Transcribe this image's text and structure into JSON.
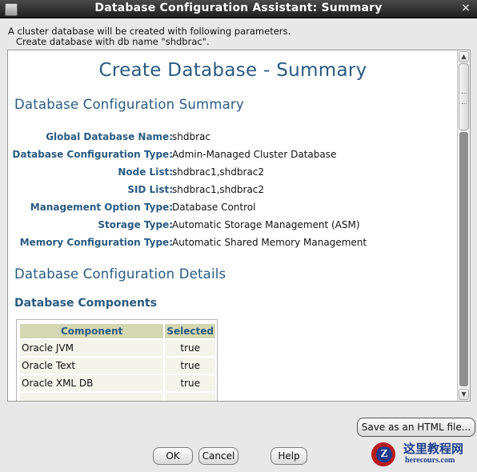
{
  "window": {
    "title": "Database Configuration Assistant: Summary",
    "close_glyph": "×"
  },
  "intro": {
    "line1": "A cluster database will be created with following parameters.",
    "line2": "Create database with db name \"shdbrac\"."
  },
  "summary": {
    "title": "Create Database - Summary",
    "section_heading": "Database Configuration Summary",
    "fields": [
      {
        "label": "Global Database Name:",
        "value": "shdbrac"
      },
      {
        "label": "Database Configuration Type:",
        "value": "Admin-Managed Cluster Database"
      },
      {
        "label": "Node List:",
        "value": "shdbrac1,shdbrac2"
      },
      {
        "label": "SID List:",
        "value": "shdbrac1,shdbrac2"
      },
      {
        "label": "Management Option Type:",
        "value": "Database Control"
      },
      {
        "label": "Storage Type:",
        "value": "Automatic Storage Management (ASM)"
      },
      {
        "label": "Memory Configuration Type:",
        "value": "Automatic Shared Memory Management"
      }
    ],
    "details_heading": "Database Configuration Details",
    "components_heading": "Database Components",
    "components_table": {
      "headers": [
        "Component",
        "Selected"
      ],
      "rows": [
        [
          "Oracle JVM",
          "true"
        ],
        [
          "Oracle Text",
          "true"
        ],
        [
          "Oracle XML DB",
          "true"
        ]
      ]
    }
  },
  "buttons": {
    "save_html": "Save as an HTML file...",
    "ok": "OK",
    "cancel": "Cancel",
    "help": "Help"
  },
  "watermark": {
    "logo_letter": "Z",
    "chinese": "这里教程网",
    "english": "herecours.com"
  },
  "colors": {
    "heading": "#2b5b7f",
    "table_header_bg": "#d4d7b4",
    "table_cell_bg": "#f4f4ea",
    "titlebar_bg": "#2a2a2a"
  }
}
